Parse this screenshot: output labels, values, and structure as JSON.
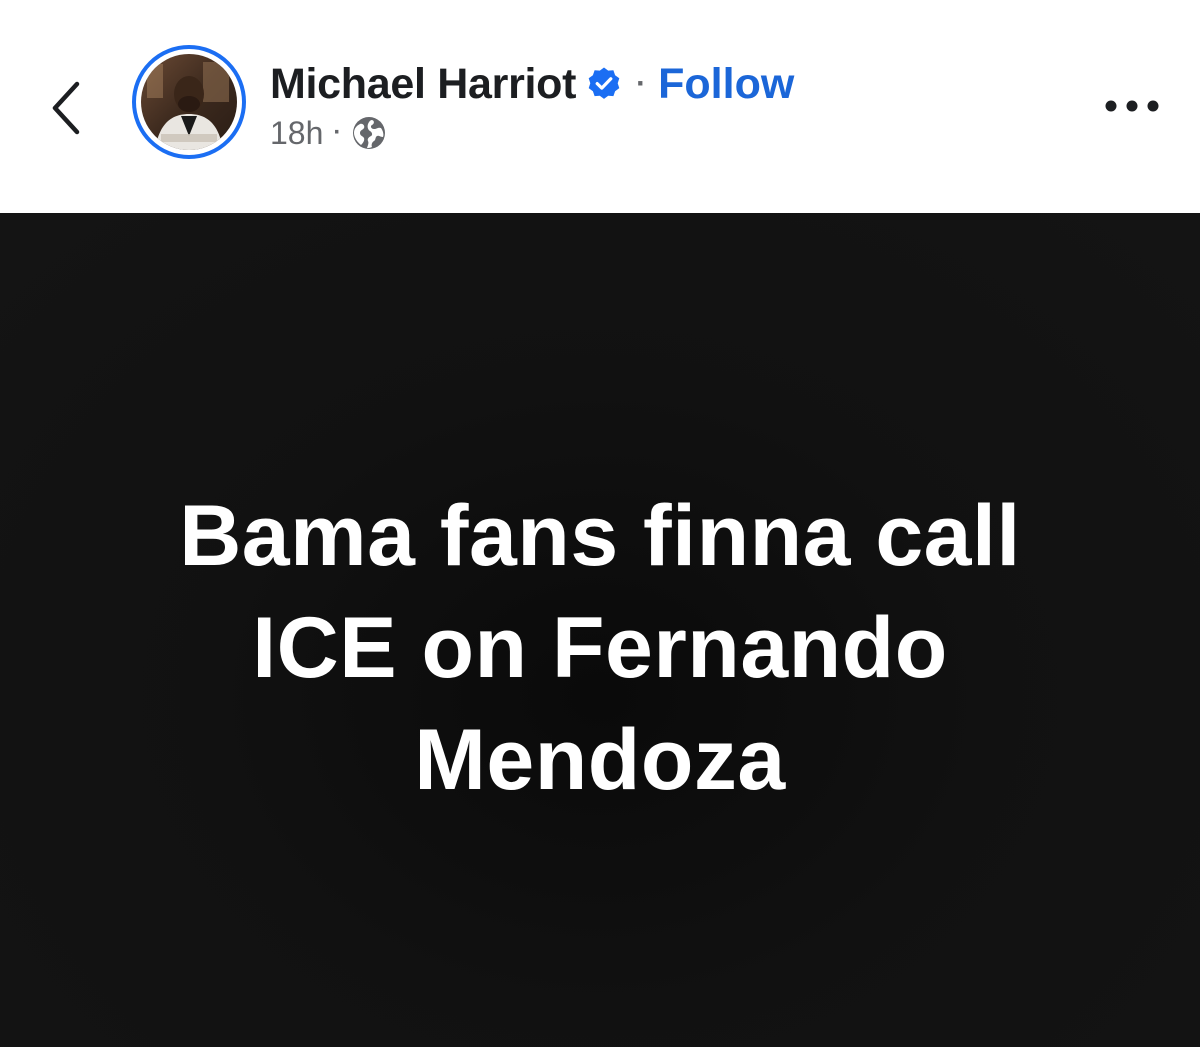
{
  "post": {
    "author": {
      "name": "Michael Harriot",
      "verified": true,
      "follow_label": "Follow",
      "separator": "·"
    },
    "meta": {
      "time": "18h",
      "separator": "·",
      "audience_icon": "globe-icon"
    },
    "content": {
      "text": "Bama fans finna call\nICE on  Fernando\nMendoza",
      "background": "#111111",
      "text_color": "#ffffff"
    }
  },
  "icons": {
    "back": "chevron-left-icon",
    "verified": "verified-badge-icon",
    "more": "more-options-icon"
  },
  "colors": {
    "accent": "#1b66d8",
    "avatar_ring": "#1b6ef3",
    "secondary_text": "#65676b",
    "primary_text": "#1c1e21"
  }
}
